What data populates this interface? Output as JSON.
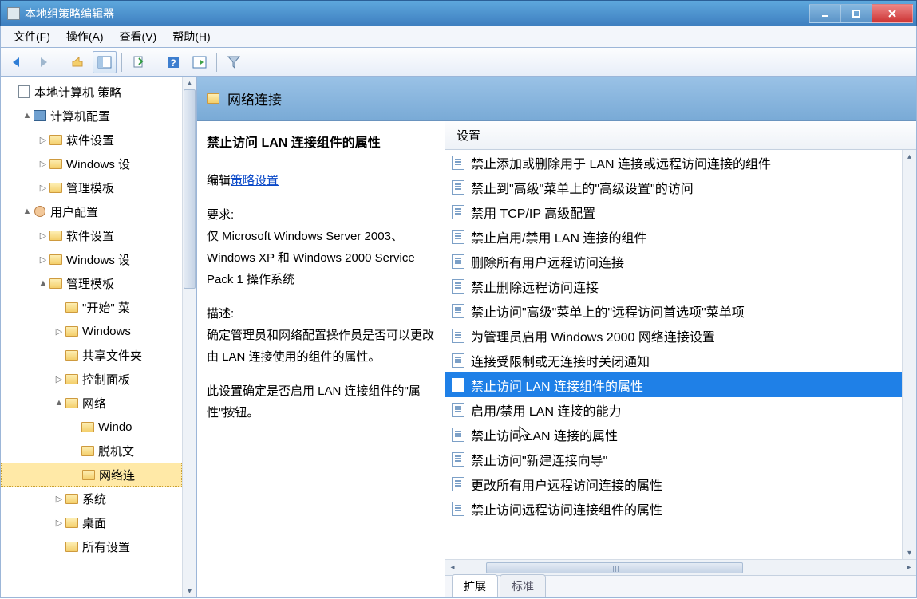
{
  "window": {
    "title": "本地组策略编辑器"
  },
  "menu": {
    "file": "文件(F)",
    "action": "操作(A)",
    "view": "查看(V)",
    "help": "帮助(H)"
  },
  "tree": {
    "items": [
      {
        "depth": 0,
        "twist": "",
        "icon": "doc",
        "label": "本地计算机 策略"
      },
      {
        "depth": 1,
        "twist": "▲",
        "icon": "comp",
        "label": "计算机配置"
      },
      {
        "depth": 2,
        "twist": "▷",
        "icon": "fold",
        "label": "软件设置"
      },
      {
        "depth": 2,
        "twist": "▷",
        "icon": "fold",
        "label": "Windows 设"
      },
      {
        "depth": 2,
        "twist": "▷",
        "icon": "fold",
        "label": "管理模板"
      },
      {
        "depth": 1,
        "twist": "▲",
        "icon": "usr",
        "label": "用户配置"
      },
      {
        "depth": 2,
        "twist": "▷",
        "icon": "fold",
        "label": "软件设置"
      },
      {
        "depth": 2,
        "twist": "▷",
        "icon": "fold",
        "label": "Windows 设"
      },
      {
        "depth": 2,
        "twist": "▲",
        "icon": "fold",
        "label": "管理模板"
      },
      {
        "depth": 3,
        "twist": "",
        "icon": "fold",
        "label": "\"开始\" 菜"
      },
      {
        "depth": 3,
        "twist": "▷",
        "icon": "fold",
        "label": "Windows"
      },
      {
        "depth": 3,
        "twist": "",
        "icon": "fold",
        "label": "共享文件夹"
      },
      {
        "depth": 3,
        "twist": "▷",
        "icon": "fold",
        "label": "控制面板"
      },
      {
        "depth": 3,
        "twist": "▲",
        "icon": "fold",
        "label": "网络"
      },
      {
        "depth": 4,
        "twist": "",
        "icon": "fold",
        "label": "Windo"
      },
      {
        "depth": 4,
        "twist": "",
        "icon": "fold",
        "label": "脱机文"
      },
      {
        "depth": 4,
        "twist": "",
        "icon": "fold",
        "label": "网络连",
        "sel": true
      },
      {
        "depth": 3,
        "twist": "▷",
        "icon": "fold",
        "label": "系统"
      },
      {
        "depth": 3,
        "twist": "▷",
        "icon": "fold",
        "label": "桌面"
      },
      {
        "depth": 3,
        "twist": "",
        "icon": "fold",
        "label": "所有设置"
      }
    ]
  },
  "header": {
    "title": "网络连接"
  },
  "detail": {
    "title": "禁止访问 LAN 连接组件的属性",
    "edit_prefix": "编辑",
    "edit_link": "策略设置",
    "req_label": "要求:",
    "req_text": "仅 Microsoft Windows Server 2003、Windows XP 和 Windows 2000 Service Pack 1 操作系统",
    "desc_label": "描述:",
    "desc1": "确定管理员和网络配置操作员是否可以更改由 LAN 连接使用的组件的属性。",
    "desc2": "此设置确定是否启用 LAN 连接组件的\"属性\"按钮。"
  },
  "list": {
    "header": "设置",
    "items": [
      "禁止添加或删除用于 LAN 连接或远程访问连接的组件",
      "禁止到\"高级\"菜单上的\"高级设置\"的访问",
      "禁用 TCP/IP 高级配置",
      "禁止启用/禁用 LAN 连接的组件",
      "删除所有用户远程访问连接",
      "禁止删除远程访问连接",
      "禁止访问\"高级\"菜单上的\"远程访问首选项\"菜单项",
      "为管理员启用 Windows 2000 网络连接设置",
      "连接受限制或无连接时关闭通知",
      "禁止访问 LAN 连接组件的属性",
      "启用/禁用 LAN 连接的能力",
      "禁止访问 LAN 连接的属性",
      "禁止访问\"新建连接向导\"",
      "更改所有用户远程访问连接的属性",
      "禁止访问远程访问连接组件的属性"
    ],
    "selected": 9
  },
  "tabs": {
    "extended": "扩展",
    "standard": "标准"
  }
}
